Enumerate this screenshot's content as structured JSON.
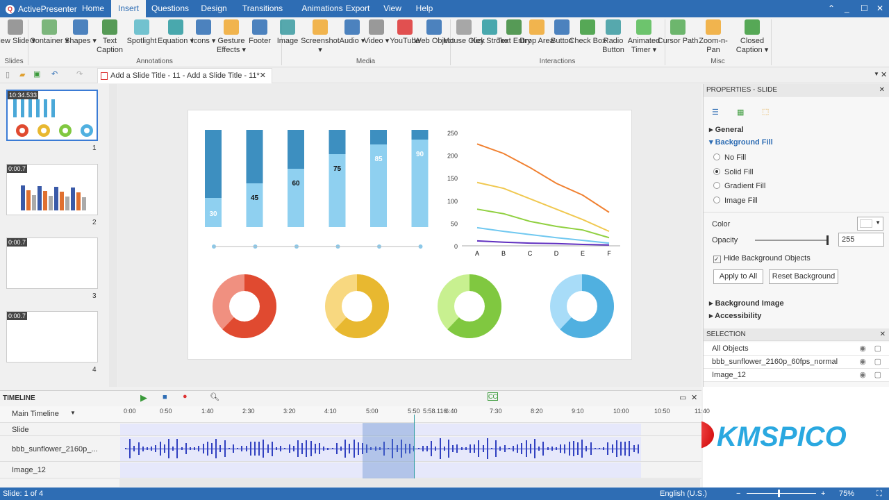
{
  "app": {
    "title": "ActivePresenter"
  },
  "menu_tabs": [
    "Home",
    "Insert",
    "Questions",
    "Design",
    "Transitions",
    "Animations",
    "Export",
    "View",
    "Help"
  ],
  "active_tab": "Insert",
  "ribbon": {
    "groups": [
      {
        "name": "Slides",
        "items": [
          {
            "label": "New Slide ▾",
            "icon": "new-slide-icon",
            "color": "#888"
          }
        ]
      },
      {
        "name": "Annotations",
        "items": [
          {
            "label": "Container ▾",
            "icon": "container-icon",
            "color": "#6a6"
          },
          {
            "label": "Shapes ▾",
            "icon": "shapes-icon",
            "color": "#2e6db4"
          },
          {
            "label": "Text Caption",
            "icon": "text-caption-icon",
            "color": "#3a8a3a"
          },
          {
            "label": "Spotlight",
            "icon": "spotlight-icon",
            "color": "#5bb8c8"
          },
          {
            "label": "Equation ▾",
            "icon": "pi-icon",
            "color": "#2a9aa0"
          },
          {
            "label": "Icons ▾",
            "icon": "airplane-icon",
            "color": "#2e6db4"
          },
          {
            "label": "Gesture Effects ▾",
            "icon": "gesture-icon",
            "color": "#f0a830"
          },
          {
            "label": "Footer",
            "icon": "footer-icon",
            "color": "#2e6db4"
          }
        ]
      },
      {
        "name": "Media",
        "items": [
          {
            "label": "Image",
            "icon": "image-icon",
            "color": "#3a9aa0"
          },
          {
            "label": "Screenshot ▾",
            "icon": "screenshot-icon",
            "color": "#f0a830"
          },
          {
            "label": "Audio ▾",
            "icon": "audio-icon",
            "color": "#2e6db4"
          },
          {
            "label": "Video ▾",
            "icon": "video-icon",
            "color": "#888"
          },
          {
            "label": "YouTube",
            "icon": "youtube-icon",
            "color": "#d33"
          },
          {
            "label": "Web Object",
            "icon": "globe-icon",
            "color": "#2e6db4"
          }
        ]
      },
      {
        "name": "Interactions",
        "items": [
          {
            "label": "Mouse Click",
            "icon": "mouse-icon",
            "color": "#999"
          },
          {
            "label": "Key Stroke",
            "icon": "key-stroke-icon",
            "color": "#2a9aa0"
          },
          {
            "label": "Text Entry",
            "icon": "text-entry-icon",
            "color": "#3a8a3a"
          },
          {
            "label": "Drop Area",
            "icon": "drop-area-icon",
            "color": "#f0a830"
          },
          {
            "label": "Button",
            "icon": "ok-button-icon",
            "color": "#2e6db4"
          },
          {
            "label": "Check Box",
            "icon": "checkbox-icon",
            "color": "#3a9a3a"
          },
          {
            "label": "Radio Button",
            "icon": "radio-icon",
            "color": "#3a9aa0"
          },
          {
            "label": "Animated Timer ▾",
            "icon": "timer-icon",
            "color": "#5b5"
          }
        ]
      },
      {
        "name": "Misc",
        "items": [
          {
            "label": "Cursor Path",
            "icon": "cursor-path-icon",
            "color": "#5a5"
          },
          {
            "label": "Zoom-n-Pan",
            "icon": "zoom-pan-icon",
            "color": "#f0a830"
          },
          {
            "label": "Closed Caption ▾",
            "icon": "cc-icon",
            "color": "#3a9a3a"
          }
        ]
      }
    ]
  },
  "document_tab": "Add a Slide Title - 11 - Add a Slide Title - 11*",
  "thumbnails": [
    {
      "badge": "10:34.533",
      "num": "1"
    },
    {
      "badge": "0:00.7",
      "num": "2"
    },
    {
      "badge": "0:00.7",
      "num": "3"
    },
    {
      "badge": "0:00.7",
      "num": "4"
    }
  ],
  "slide": {
    "bars": [
      30,
      45,
      60,
      75,
      85,
      90
    ],
    "line_chart": {
      "yticks": [
        "250",
        "200",
        "150",
        "100",
        "50",
        "0"
      ],
      "categories": [
        "A",
        "B",
        "C",
        "D",
        "E",
        "F"
      ],
      "ymax": 250,
      "series": [
        {
          "color": "#f08030",
          "values": [
            225,
            204,
            173,
            138,
            112,
            74
          ]
        },
        {
          "color": "#f0c850",
          "values": [
            140,
            127,
            104,
            81,
            58,
            32
          ]
        },
        {
          "color": "#90d040",
          "values": [
            81,
            71,
            54,
            43,
            35,
            18
          ]
        },
        {
          "color": "#70c8f0",
          "values": [
            40,
            32,
            25,
            18,
            12,
            6
          ]
        },
        {
          "color": "#6030c0",
          "values": [
            11,
            8,
            6,
            5,
            3,
            2
          ]
        }
      ]
    },
    "donuts": [
      {
        "color": "#e04a30",
        "light": "#f09080"
      },
      {
        "color": "#e8b830",
        "light": "#f8d880"
      },
      {
        "color": "#80c840",
        "light": "#c8f090"
      },
      {
        "color": "#50b0e0",
        "light": "#a8dcf8"
      }
    ]
  },
  "properties": {
    "title": "PROPERTIES - SLIDE",
    "sections": {
      "general": "General",
      "background_fill": "Background Fill",
      "background_image": "Background Image",
      "accessibility": "Accessibility"
    },
    "fill_options": [
      "No Fill",
      "Solid Fill",
      "Gradient Fill",
      "Image Fill"
    ],
    "selected_fill": "Solid Fill",
    "color_label": "Color",
    "opacity_label": "Opacity",
    "opacity_value": "255",
    "hide_bg_label": "Hide Background Objects",
    "apply_all": "Apply to All",
    "reset_bg": "Reset Background"
  },
  "selection": {
    "title": "SELECTION",
    "items": [
      "All Objects",
      "bbb_sunflower_2160p_60fps_normal",
      "Image_12"
    ]
  },
  "timeline": {
    "title": "TIMELINE",
    "main": "Main Timeline",
    "ticks": [
      "0:00",
      "0:50",
      "1:40",
      "2:30",
      "3:20",
      "4:10",
      "5:00",
      "5:50",
      "5:58.116",
      "6:40",
      "7:30",
      "8:20",
      "9:10",
      "10:00",
      "10:50",
      "11:40"
    ],
    "rows": [
      "Slide",
      "bbb_sunflower_2160p_...",
      "Image_12"
    ]
  },
  "status": {
    "slide": "Slide: 1 of 4",
    "language": "English (U.S.)",
    "zoom": "75%"
  }
}
